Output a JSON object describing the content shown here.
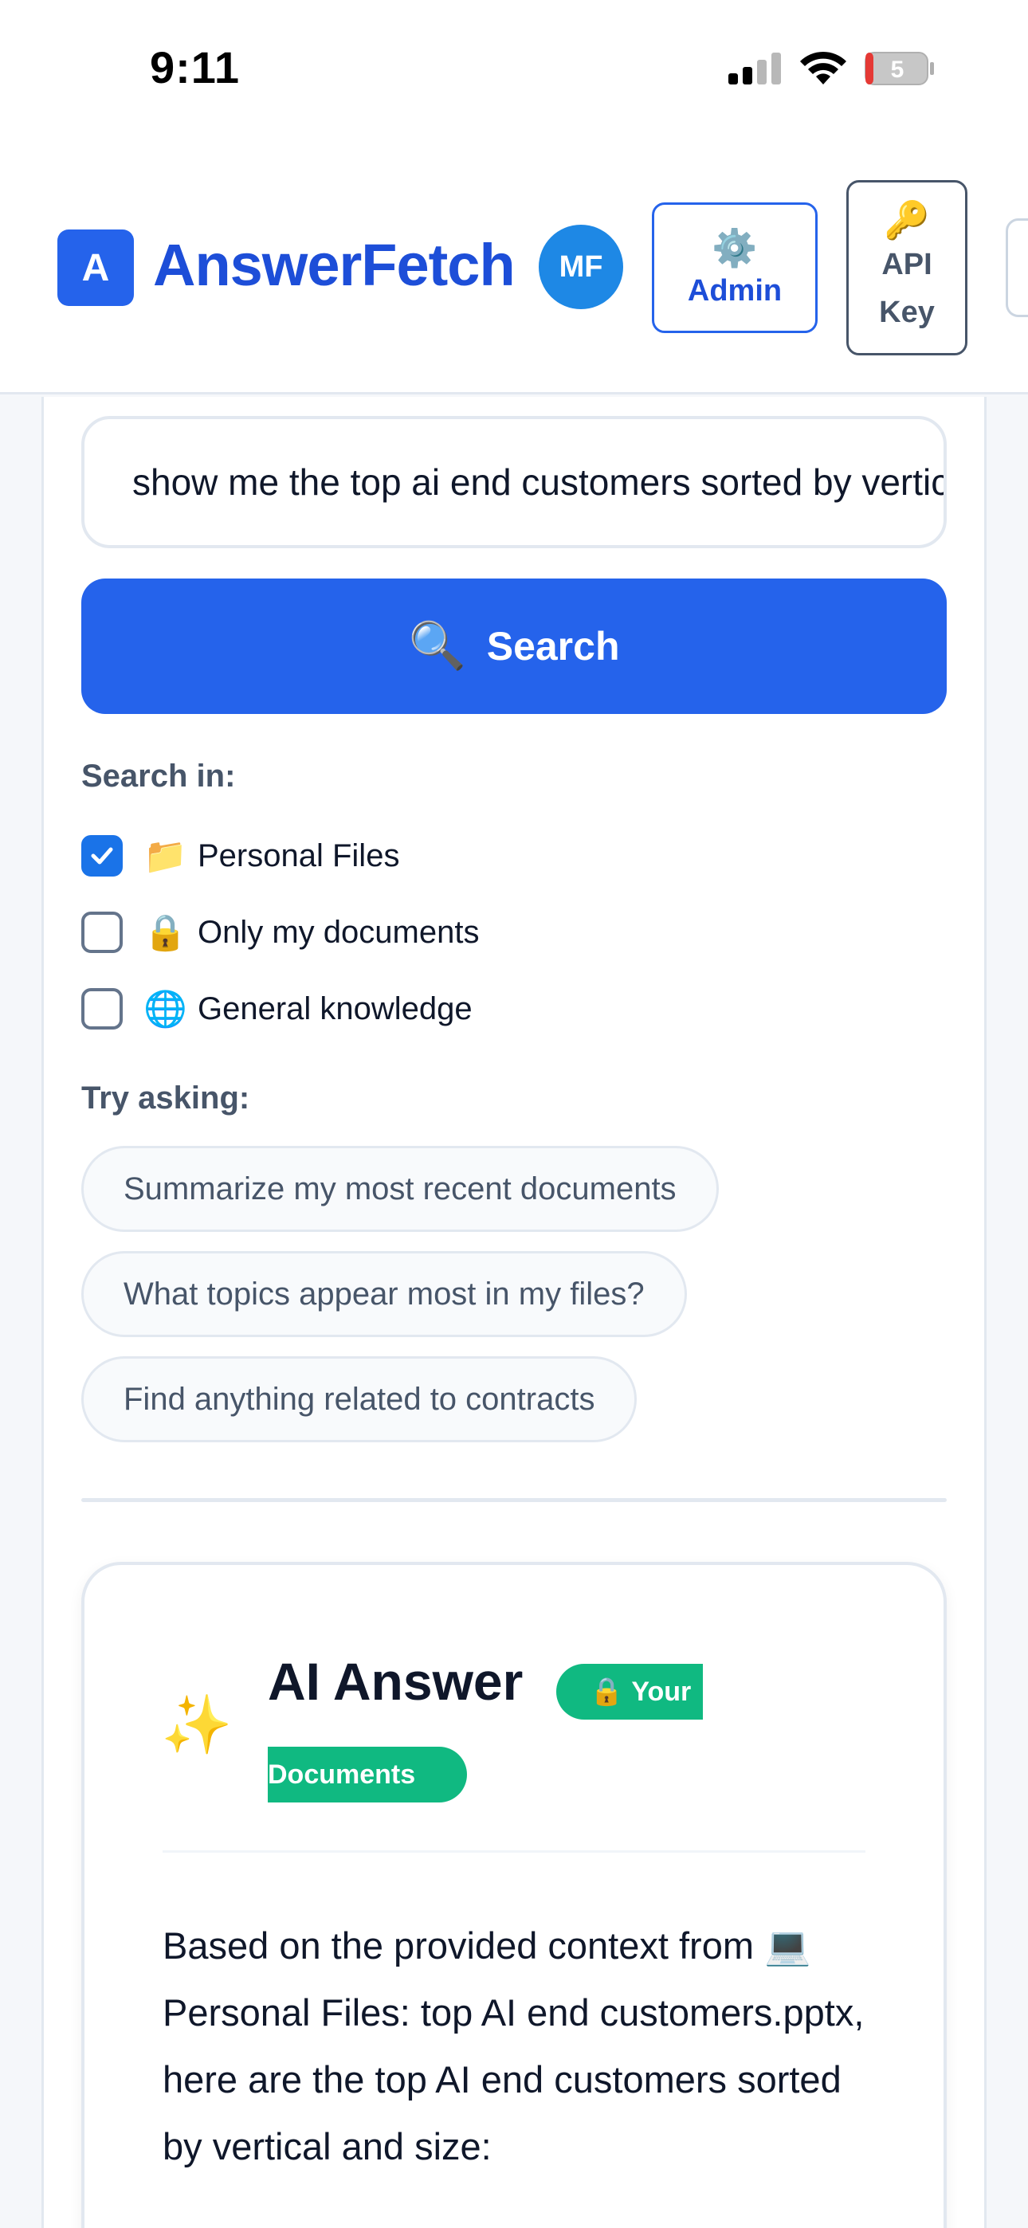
{
  "status": {
    "time": "9:11",
    "battery": "5"
  },
  "header": {
    "logo_letter": "A",
    "brand": "AnswerFetch",
    "avatar": "MF",
    "admin": {
      "icon": "⚙️",
      "label": "Admin"
    },
    "api_key": {
      "icon": "🔑",
      "label": "API Key"
    }
  },
  "search": {
    "query": "show me the top ai end customers sorted by vertical and size",
    "button": {
      "icon": "🔍",
      "label": "Search"
    }
  },
  "search_in": {
    "label": "Search in:",
    "options": [
      {
        "icon": "📁",
        "label": "Personal Files",
        "checked": true
      },
      {
        "icon": "🔒",
        "label": "Only my documents",
        "checked": false
      },
      {
        "icon": "🌐",
        "label": "General knowledge",
        "checked": false
      }
    ]
  },
  "try_asking": {
    "label": "Try asking:",
    "suggestions": [
      "Summarize my most recent documents",
      "What topics appear most in my files?",
      "Find anything related to contracts"
    ]
  },
  "answer": {
    "icon": "✨",
    "title": "AI Answer",
    "badge_icon": "🔒",
    "badge_line1": "Your",
    "badge_line2": "Documents",
    "body": "Based on the provided context from 💻 Personal Files: top AI end customers.pptx, here are the top AI end customers sorted by vertical and size:"
  },
  "colors": {
    "primary": "#2563eb",
    "badge": "#10b981",
    "checkbox_checked": "#1a73e8",
    "muted_text": "#475569"
  }
}
